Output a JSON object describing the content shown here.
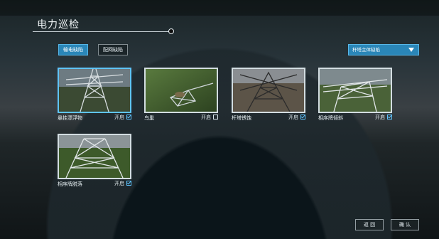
{
  "header": {
    "title": "电力巡检"
  },
  "tabs": [
    {
      "label": "输电缺陷",
      "active": true
    },
    {
      "label": "配网缺陷",
      "active": false
    }
  ],
  "filter": {
    "selected": "杆塔主体缺陷"
  },
  "cards": [
    {
      "label": "悬挂漂浮物",
      "toggle_label": "开启",
      "enabled": true,
      "selected": true,
      "image": "tower-image"
    },
    {
      "label": "鸟巢",
      "toggle_label": "开启",
      "enabled": false,
      "selected": false,
      "image": "bird-nest-image"
    },
    {
      "label": "杆塔锈蚀",
      "toggle_label": "开启",
      "enabled": true,
      "selected": false,
      "image": "tower-image"
    },
    {
      "label": "相序牌倾斜",
      "toggle_label": "开启",
      "enabled": true,
      "selected": false,
      "image": "tower-image"
    },
    {
      "label": "相序牌脱落",
      "toggle_label": "开启",
      "enabled": true,
      "selected": false,
      "image": "tower-image"
    }
  ],
  "footer": {
    "back": "返 回",
    "confirm": "确 认"
  },
  "colors": {
    "accent": "#2a86b8",
    "selected_border": "#5fc4ff"
  }
}
